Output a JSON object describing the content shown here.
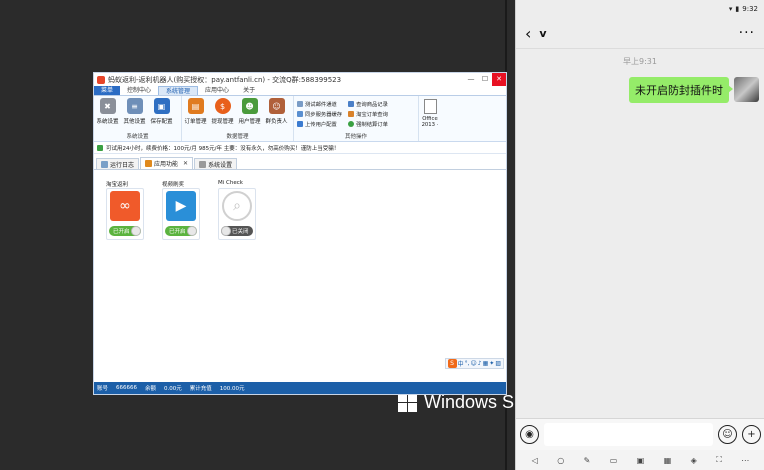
{
  "desktop": {
    "os_label": "Windows S"
  },
  "app": {
    "title": "蚂蚁返利-返利机器人(购买授权：pay.antfanli.cn) - 交流Q群:588399523",
    "window_controls": {
      "minimize": "—",
      "maximize": "☐",
      "close": "✕"
    },
    "menu": [
      "菜单",
      "控制中心",
      "系统管理",
      "应用中心",
      "关于"
    ],
    "ribbon": {
      "groups": [
        {
          "label": "系统设置",
          "buttons": [
            {
              "label": "系统设置",
              "icon": "wrench-icon",
              "color": "#8a8f99"
            },
            {
              "label": "其他设置",
              "icon": "document-icon",
              "color": "#6f8fb8"
            },
            {
              "label": "保存配置",
              "icon": "save-icon",
              "color": "#2f6fc2"
            }
          ]
        },
        {
          "label": "数据管理",
          "buttons": [
            {
              "label": "订单管理",
              "icon": "order-icon",
              "color": "#e07b20"
            },
            {
              "label": "提现管理",
              "icon": "money-icon",
              "color": "#e8601c"
            },
            {
              "label": "用户管理",
              "icon": "users-icon",
              "color": "#4a9b3c"
            },
            {
              "label": "群负责人",
              "icon": "person-icon",
              "color": "#b0603a"
            }
          ]
        },
        {
          "label": "其他操作",
          "list_a": [
            "测试邮件通道",
            "同步服务器缓存",
            "上传用户配置"
          ],
          "list_b": [
            "查询商品记录",
            "淘宝订单查询",
            "强制结算订单"
          ],
          "office": "Office 2013 ·"
        }
      ]
    },
    "info": "可试用24小时，续费价格：100元/月 985元/年 主要：没有永久，勿高价购买！谨防上当受骗！",
    "tabs": [
      {
        "label": "运行日志",
        "active": false
      },
      {
        "label": "应用功能",
        "active": true,
        "closable": true
      },
      {
        "label": "系统设置",
        "active": false
      }
    ],
    "apps": [
      {
        "title": "淘宝返利",
        "icon": "taobao-icon",
        "color": "#f05a2a",
        "toggle": "已开启",
        "on": true
      },
      {
        "title": "视频刷奖",
        "icon": "video-icon",
        "color": "#2a8fd8",
        "toggle": "已开启",
        "on": true
      },
      {
        "title": "Mi Check",
        "icon": "check-icon",
        "color": "#bdbdbd",
        "toggle": "已关闭",
        "on": false
      }
    ],
    "status": {
      "account_label": "账号",
      "account": "666666",
      "balance_label": "余额",
      "balance": "0.00元",
      "recharge_label": "累计充值",
      "recharge": "100.00元"
    },
    "ime": {
      "lang": "中"
    }
  },
  "phone": {
    "time": "9:32",
    "chat_name": "v",
    "time_label": "早上9:31",
    "message": "未开启防封插件时"
  }
}
